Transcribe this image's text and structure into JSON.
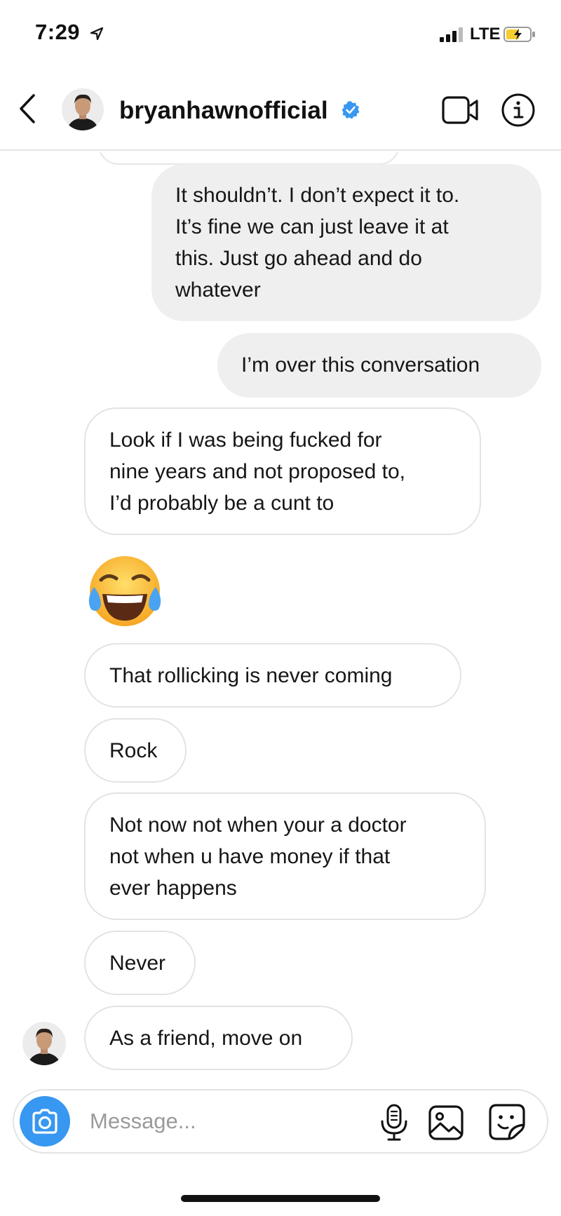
{
  "status_bar": {
    "time": "7:29",
    "network": "LTE",
    "icons": [
      "location-arrow-icon",
      "signal-bars-icon",
      "battery-charging-icon"
    ]
  },
  "header": {
    "username": "bryanhawnofficial",
    "verified": true,
    "icons": [
      "chevron-left-icon",
      "verified-badge-icon",
      "video-camera-icon",
      "info-icon"
    ]
  },
  "messages": [
    {
      "direction": "sent",
      "text": "It shouldn’t. I don’t expect it to.\nIt’s fine we can just leave it at\nthis. Just go ahead and do\nwhatever"
    },
    {
      "direction": "sent",
      "text": "I’m over this conversation"
    },
    {
      "direction": "received",
      "text": "Look if I was being fucked for\nnine years and not proposed to,\nI’d probably be a cunt to"
    },
    {
      "direction": "received",
      "type": "emoji",
      "icon": "face-with-tears-of-joy-icon"
    },
    {
      "direction": "received",
      "text": "That rollicking is never coming"
    },
    {
      "direction": "received",
      "text": "Rock"
    },
    {
      "direction": "received",
      "text": "Not now not when your a doctor\nnot when u have money if that\never happens"
    },
    {
      "direction": "received",
      "text": "Never"
    },
    {
      "direction": "received",
      "text": "As a friend, move on"
    }
  ],
  "composer": {
    "placeholder": "Message...",
    "icons": [
      "camera-icon",
      "microphone-icon",
      "gallery-icon",
      "sticker-icon"
    ]
  },
  "colors": {
    "accent": "#3897f0",
    "sent_bubble": "#efefef",
    "received_border": "#e3e3e3",
    "verified": "#3897f0"
  }
}
